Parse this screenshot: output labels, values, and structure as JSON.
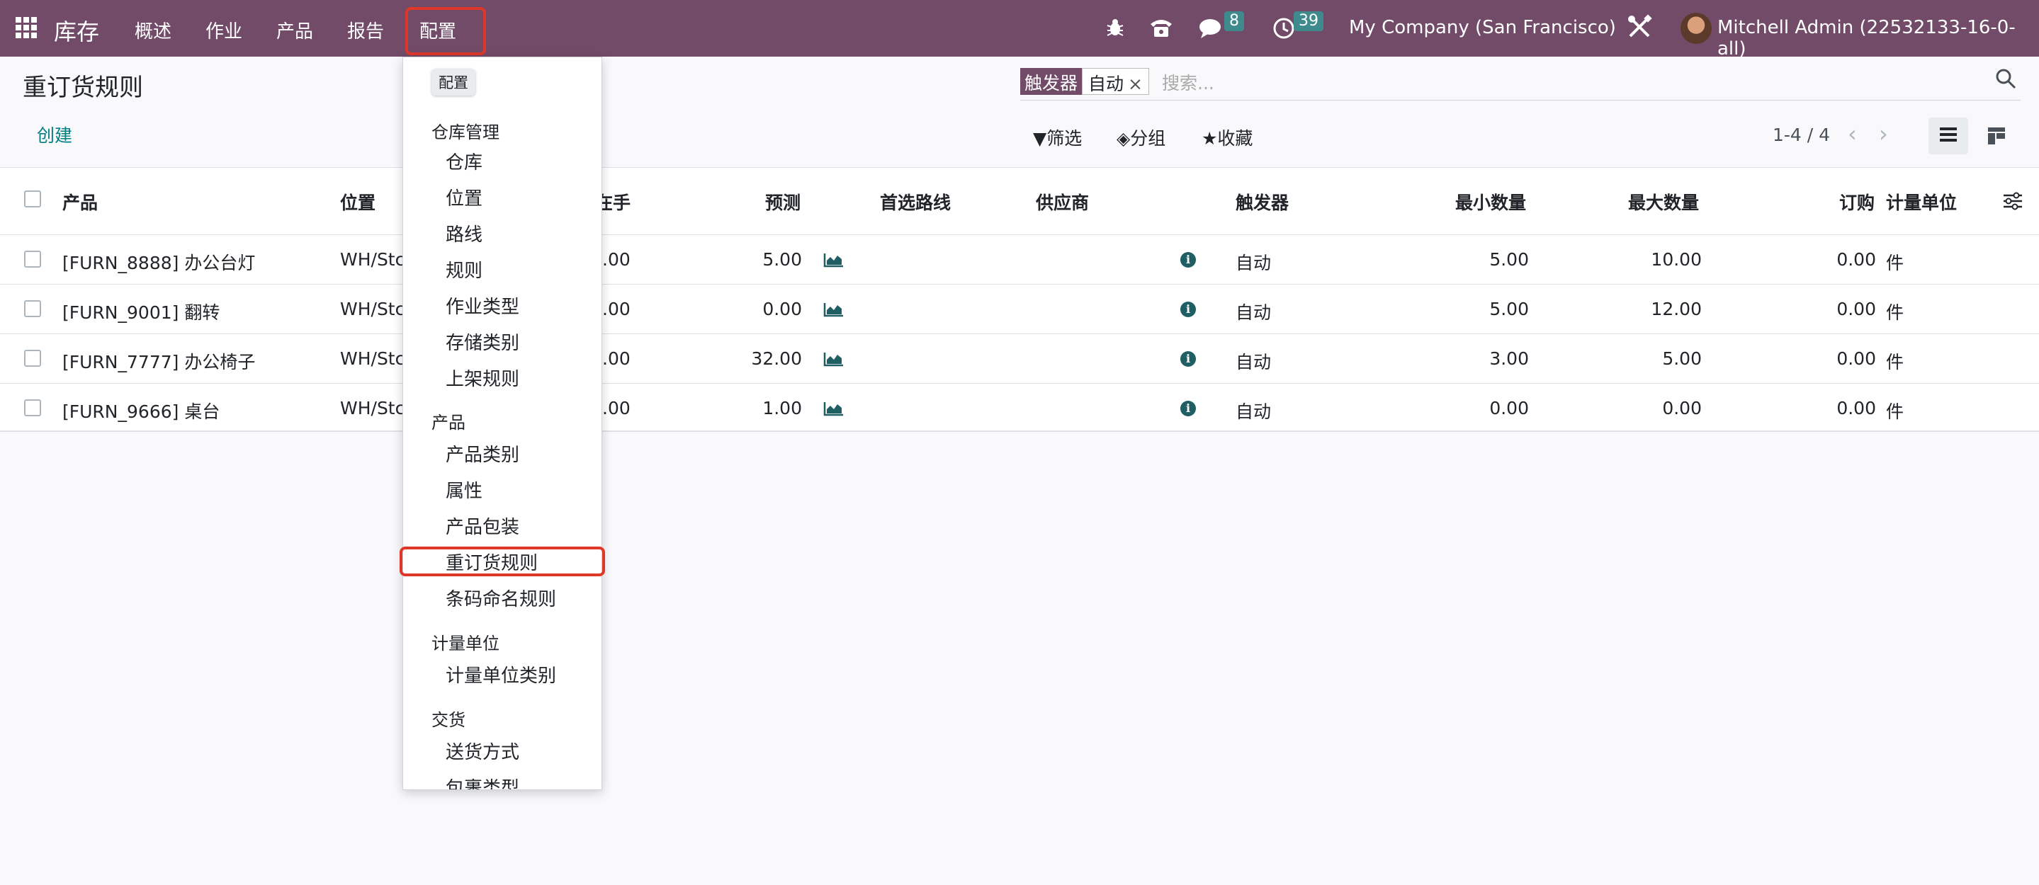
{
  "navbar": {
    "brand": "库存",
    "menus": [
      "概述",
      "作业",
      "产品",
      "报告",
      "配置"
    ],
    "discuss_count": "8",
    "activity_count": "39",
    "company": "My Company (San Francisco)",
    "user": "Mitchell Admin (22532133-16-0-all)"
  },
  "page": {
    "title": "重订货规则",
    "create_label": "创建"
  },
  "search": {
    "facet_label": "触发器",
    "facet_value": "自动",
    "placeholder": "搜索..."
  },
  "filters": {
    "filter_label": "筛选",
    "group_label": "分组",
    "favorites_label": "收藏"
  },
  "pager": {
    "text": "1-4 / 4"
  },
  "table": {
    "headers": {
      "product": "产品",
      "location": "位置",
      "onhand": "在手",
      "forecast": "预测",
      "route": "首选路线",
      "vendor": "供应商",
      "trigger": "触发器",
      "min_qty": "最小数量",
      "max_qty": "最大数量",
      "order_qty": "订购",
      "uom": "计量单位"
    },
    "rows": [
      {
        "product": "[FURN_8888] 办公台灯",
        "location": "WH/Stc",
        "onhand": ".00",
        "forecast": "5.00",
        "trigger": "自动",
        "min": "5.00",
        "max": "10.00",
        "order": "0.00",
        "uom": "件"
      },
      {
        "product": "[FURN_9001] 翻转",
        "location": "WH/Stc",
        "onhand": ".00",
        "forecast": "0.00",
        "trigger": "自动",
        "min": "5.00",
        "max": "12.00",
        "order": "0.00",
        "uom": "件"
      },
      {
        "product": "[FURN_7777] 办公椅子",
        "location": "WH/Stc",
        "onhand": ".00",
        "forecast": "32.00",
        "trigger": "自动",
        "min": "3.00",
        "max": "5.00",
        "order": "0.00",
        "uom": "件"
      },
      {
        "product": "[FURN_9666] 桌台",
        "location": "WH/Stc",
        "onhand": ".00",
        "forecast": "1.00",
        "trigger": "自动",
        "min": "0.00",
        "max": "0.00",
        "order": "0.00",
        "uom": "件"
      }
    ]
  },
  "dropdown": {
    "tooltip": "配置",
    "sections": [
      {
        "header": "仓库管理",
        "items": [
          "仓库",
          "位置",
          "路线",
          "规则",
          "作业类型",
          "存储类别",
          "上架规则"
        ]
      },
      {
        "header": "产品",
        "items": [
          "产品类别",
          "属性",
          "产品包装",
          "重订货规则",
          "条码命名规则"
        ]
      },
      {
        "header": "计量单位",
        "items": [
          "计量单位类别"
        ]
      },
      {
        "header": "交货",
        "items": [
          "送货方式",
          "包裹类型"
        ]
      }
    ]
  },
  "colors": {
    "navbar": "#714b67",
    "accent": "#017e84",
    "highlight": "#e0372b",
    "badge": "#3e8a8d"
  }
}
